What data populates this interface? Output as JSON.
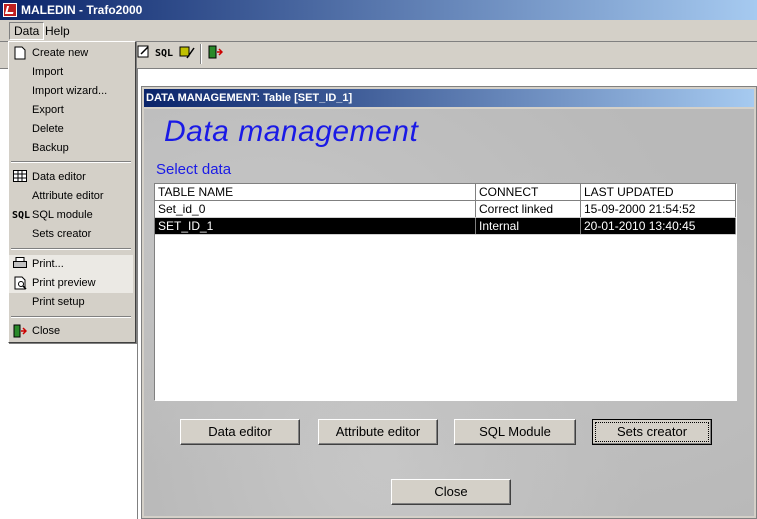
{
  "window": {
    "title": "MALEDIN - Trafo2000"
  },
  "menubar": {
    "data_label": "Data",
    "help_label": "Help"
  },
  "toolbar": {
    "sql_label": "SQL"
  },
  "data_menu": {
    "items": [
      {
        "label": "Create new"
      },
      {
        "label": "Import"
      },
      {
        "label": "Import wizard..."
      },
      {
        "label": "Export"
      },
      {
        "label": "Delete"
      },
      {
        "label": "Backup"
      },
      {
        "label": "Data editor"
      },
      {
        "label": "Attribute editor"
      },
      {
        "label": "SQL module",
        "icon_text": "SQL"
      },
      {
        "label": "Sets creator"
      },
      {
        "label": "Print..."
      },
      {
        "label": "Print preview"
      },
      {
        "label": "Print setup"
      },
      {
        "label": "Close"
      }
    ]
  },
  "child_window": {
    "title": "DATA MANAGEMENT: Table [SET_ID_1]",
    "heading": "Data management",
    "select_label": "Select data",
    "columns": [
      "TABLE NAME",
      "CONNECT",
      "LAST UPDATED"
    ],
    "rows": [
      [
        "Set_id_0",
        "Correct linked",
        "15-09-2000 21:54:52"
      ],
      [
        "SET_ID_1",
        "Internal",
        "20-01-2010 13:40:45"
      ]
    ],
    "buttons": {
      "data_editor": "Data editor",
      "attribute_editor": "Attribute editor",
      "sql_module": "SQL Module",
      "sets_creator": "Sets creator",
      "close": "Close"
    }
  }
}
